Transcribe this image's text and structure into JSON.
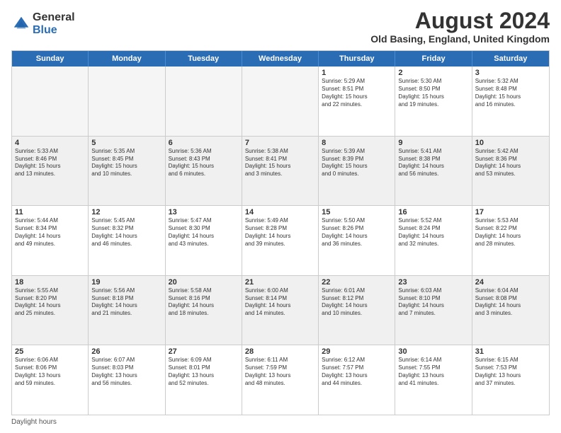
{
  "logo": {
    "general": "General",
    "blue": "Blue"
  },
  "title": "August 2024",
  "subtitle": "Old Basing, England, United Kingdom",
  "days_of_week": [
    "Sunday",
    "Monday",
    "Tuesday",
    "Wednesday",
    "Thursday",
    "Friday",
    "Saturday"
  ],
  "footer": "Daylight hours",
  "weeks": [
    [
      {
        "day": "",
        "info": ""
      },
      {
        "day": "",
        "info": ""
      },
      {
        "day": "",
        "info": ""
      },
      {
        "day": "",
        "info": ""
      },
      {
        "day": "1",
        "info": "Sunrise: 5:29 AM\nSunset: 8:51 PM\nDaylight: 15 hours\nand 22 minutes."
      },
      {
        "day": "2",
        "info": "Sunrise: 5:30 AM\nSunset: 8:50 PM\nDaylight: 15 hours\nand 19 minutes."
      },
      {
        "day": "3",
        "info": "Sunrise: 5:32 AM\nSunset: 8:48 PM\nDaylight: 15 hours\nand 16 minutes."
      }
    ],
    [
      {
        "day": "4",
        "info": "Sunrise: 5:33 AM\nSunset: 8:46 PM\nDaylight: 15 hours\nand 13 minutes."
      },
      {
        "day": "5",
        "info": "Sunrise: 5:35 AM\nSunset: 8:45 PM\nDaylight: 15 hours\nand 10 minutes."
      },
      {
        "day": "6",
        "info": "Sunrise: 5:36 AM\nSunset: 8:43 PM\nDaylight: 15 hours\nand 6 minutes."
      },
      {
        "day": "7",
        "info": "Sunrise: 5:38 AM\nSunset: 8:41 PM\nDaylight: 15 hours\nand 3 minutes."
      },
      {
        "day": "8",
        "info": "Sunrise: 5:39 AM\nSunset: 8:39 PM\nDaylight: 15 hours\nand 0 minutes."
      },
      {
        "day": "9",
        "info": "Sunrise: 5:41 AM\nSunset: 8:38 PM\nDaylight: 14 hours\nand 56 minutes."
      },
      {
        "day": "10",
        "info": "Sunrise: 5:42 AM\nSunset: 8:36 PM\nDaylight: 14 hours\nand 53 minutes."
      }
    ],
    [
      {
        "day": "11",
        "info": "Sunrise: 5:44 AM\nSunset: 8:34 PM\nDaylight: 14 hours\nand 49 minutes."
      },
      {
        "day": "12",
        "info": "Sunrise: 5:45 AM\nSunset: 8:32 PM\nDaylight: 14 hours\nand 46 minutes."
      },
      {
        "day": "13",
        "info": "Sunrise: 5:47 AM\nSunset: 8:30 PM\nDaylight: 14 hours\nand 43 minutes."
      },
      {
        "day": "14",
        "info": "Sunrise: 5:49 AM\nSunset: 8:28 PM\nDaylight: 14 hours\nand 39 minutes."
      },
      {
        "day": "15",
        "info": "Sunrise: 5:50 AM\nSunset: 8:26 PM\nDaylight: 14 hours\nand 36 minutes."
      },
      {
        "day": "16",
        "info": "Sunrise: 5:52 AM\nSunset: 8:24 PM\nDaylight: 14 hours\nand 32 minutes."
      },
      {
        "day": "17",
        "info": "Sunrise: 5:53 AM\nSunset: 8:22 PM\nDaylight: 14 hours\nand 28 minutes."
      }
    ],
    [
      {
        "day": "18",
        "info": "Sunrise: 5:55 AM\nSunset: 8:20 PM\nDaylight: 14 hours\nand 25 minutes."
      },
      {
        "day": "19",
        "info": "Sunrise: 5:56 AM\nSunset: 8:18 PM\nDaylight: 14 hours\nand 21 minutes."
      },
      {
        "day": "20",
        "info": "Sunrise: 5:58 AM\nSunset: 8:16 PM\nDaylight: 14 hours\nand 18 minutes."
      },
      {
        "day": "21",
        "info": "Sunrise: 6:00 AM\nSunset: 8:14 PM\nDaylight: 14 hours\nand 14 minutes."
      },
      {
        "day": "22",
        "info": "Sunrise: 6:01 AM\nSunset: 8:12 PM\nDaylight: 14 hours\nand 10 minutes."
      },
      {
        "day": "23",
        "info": "Sunrise: 6:03 AM\nSunset: 8:10 PM\nDaylight: 14 hours\nand 7 minutes."
      },
      {
        "day": "24",
        "info": "Sunrise: 6:04 AM\nSunset: 8:08 PM\nDaylight: 14 hours\nand 3 minutes."
      }
    ],
    [
      {
        "day": "25",
        "info": "Sunrise: 6:06 AM\nSunset: 8:06 PM\nDaylight: 13 hours\nand 59 minutes."
      },
      {
        "day": "26",
        "info": "Sunrise: 6:07 AM\nSunset: 8:03 PM\nDaylight: 13 hours\nand 56 minutes."
      },
      {
        "day": "27",
        "info": "Sunrise: 6:09 AM\nSunset: 8:01 PM\nDaylight: 13 hours\nand 52 minutes."
      },
      {
        "day": "28",
        "info": "Sunrise: 6:11 AM\nSunset: 7:59 PM\nDaylight: 13 hours\nand 48 minutes."
      },
      {
        "day": "29",
        "info": "Sunrise: 6:12 AM\nSunset: 7:57 PM\nDaylight: 13 hours\nand 44 minutes."
      },
      {
        "day": "30",
        "info": "Sunrise: 6:14 AM\nSunset: 7:55 PM\nDaylight: 13 hours\nand 41 minutes."
      },
      {
        "day": "31",
        "info": "Sunrise: 6:15 AM\nSunset: 7:53 PM\nDaylight: 13 hours\nand 37 minutes."
      }
    ]
  ]
}
